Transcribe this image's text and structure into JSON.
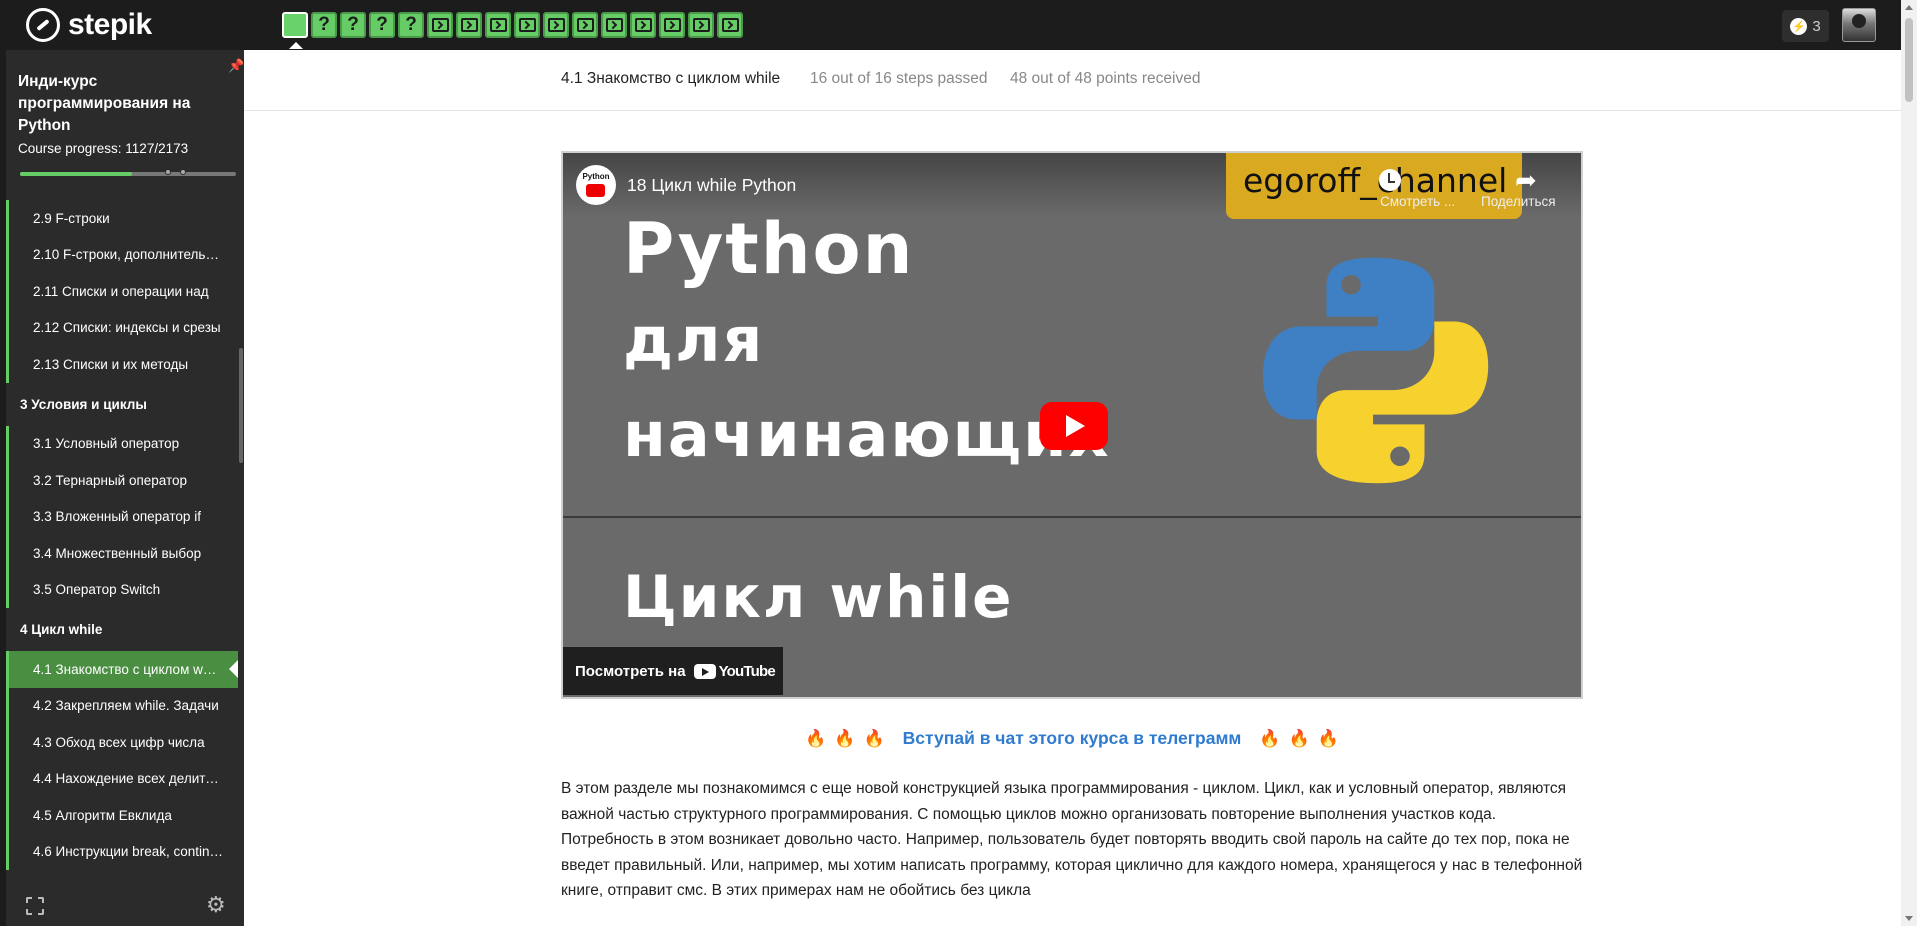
{
  "brand": {
    "name": "stepik"
  },
  "steps_bar": [
    {
      "kind": "video",
      "active": true
    },
    {
      "kind": "quiz",
      "label": "?"
    },
    {
      "kind": "quiz",
      "label": "?"
    },
    {
      "kind": "quiz",
      "label": "?"
    },
    {
      "kind": "quiz",
      "label": "?"
    },
    {
      "kind": "code"
    },
    {
      "kind": "code"
    },
    {
      "kind": "code"
    },
    {
      "kind": "code"
    },
    {
      "kind": "code"
    },
    {
      "kind": "code"
    },
    {
      "kind": "code"
    },
    {
      "kind": "code"
    },
    {
      "kind": "code"
    },
    {
      "kind": "code"
    },
    {
      "kind": "code"
    }
  ],
  "header": {
    "energy_count": "3",
    "energy_icon": "bolt-icon",
    "avatar": "user-avatar"
  },
  "sidebar": {
    "course_title": "Инди-курс программирования на Python",
    "progress_label": "Course progress:  1127/2173",
    "progress": {
      "done": 1127,
      "total": 2173
    },
    "items": [
      {
        "label": "2.9  F-строки",
        "type": "lesson"
      },
      {
        "label": "2.10  F-строки, дополнительные",
        "type": "lesson"
      },
      {
        "label": "2.11  Списки и операции над",
        "type": "lesson"
      },
      {
        "label": "2.12  Списки: индексы и срезы",
        "type": "lesson"
      },
      {
        "label": "2.13  Списки и их методы",
        "type": "lesson"
      },
      {
        "label": "3  Условия и циклы",
        "type": "section"
      },
      {
        "label": "3.1  Условный оператор",
        "type": "lesson"
      },
      {
        "label": "3.2  Тернарный оператор",
        "type": "lesson"
      },
      {
        "label": "3.3  Вложенный оператор if",
        "type": "lesson"
      },
      {
        "label": "3.4  Множественный выбор",
        "type": "lesson"
      },
      {
        "label": "3.5  Оператор Switch",
        "type": "lesson"
      },
      {
        "label": "4  Цикл while",
        "type": "section"
      },
      {
        "label": "4.1  Знакомство с циклом while",
        "type": "lesson",
        "active": true
      },
      {
        "label": "4.2  Закрепляем while. Задачи",
        "type": "lesson"
      },
      {
        "label": "4.3  Обход всех цифр числа",
        "type": "lesson"
      },
      {
        "label": "4.4  Нахождение всех делителей",
        "type": "lesson"
      },
      {
        "label": "4.5  Алгоритм Евклида",
        "type": "lesson"
      },
      {
        "label": "4.6  Инструкции break, continue",
        "type": "lesson"
      }
    ]
  },
  "lesson_header": {
    "title": "4.1 Знакомство с циклом while",
    "steps_passed": "16 out of 16 steps passed",
    "points": "48 out of 48 points  received"
  },
  "video": {
    "channel_logo_text": "Python",
    "title": "18 Цикл while Python",
    "banner": "egoroff_channel",
    "watch_later": "Смотреть ...",
    "share": "Поделиться",
    "big_line1": "Python",
    "big_line2": "для",
    "big_line3": "начинающих",
    "big_line4": "Цикл while",
    "watch_on": "Посмотреть на",
    "yt_brand": "YouTube",
    "colors": {
      "bg": "#6a6a6a",
      "banner": "#d9a920",
      "play": "#ff0000"
    }
  },
  "telegram": {
    "link": "Вступай в чат этого курса в телеграмм",
    "fire_icon": "fire-icon"
  },
  "content": {
    "paragraph": "В этом разделе мы познакомимся с еще новой конструкцией языка программирования - циклом. Цикл, как и условный оператор, являются важной частью структурного программирования. С помощью циклов можно организовать повторение выполнения участков кода. Потребность в этом возникает довольно часто. Например, пользователь будет повторять вводить свой пароль на сайте до тех пор, пока не введет правильный. Или, например, мы хотим написать программу, которая циклично для каждого номера, хранящегося у нас в телефонной книге, отправит смс. В этих примерах нам не обойтись без цикла"
  },
  "colors": {
    "topbar": "#1c1c1c",
    "sidebar": "#2b2b2b",
    "accent": "#66cc66",
    "active_item": "#4a8e42",
    "link": "#2e7bcf"
  }
}
